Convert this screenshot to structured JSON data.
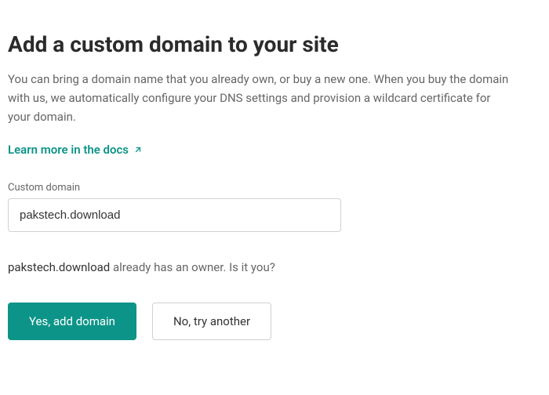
{
  "header": {
    "title": "Add a custom domain to your site",
    "description": "You can bring a domain name that you already own, or buy a new one. When you buy the domain with us, we automatically configure your DNS settings and provision a wildcard certificate for your domain."
  },
  "docsLink": {
    "label": "Learn more in the docs"
  },
  "form": {
    "domainLabel": "Custom domain",
    "domainValue": "pakstech.download"
  },
  "status": {
    "domain": "pakstech.download",
    "message": " already has an owner. Is it you?"
  },
  "actions": {
    "confirm": "Yes, add domain",
    "cancel": "No, try another"
  },
  "colors": {
    "accent": "#0d9488"
  }
}
